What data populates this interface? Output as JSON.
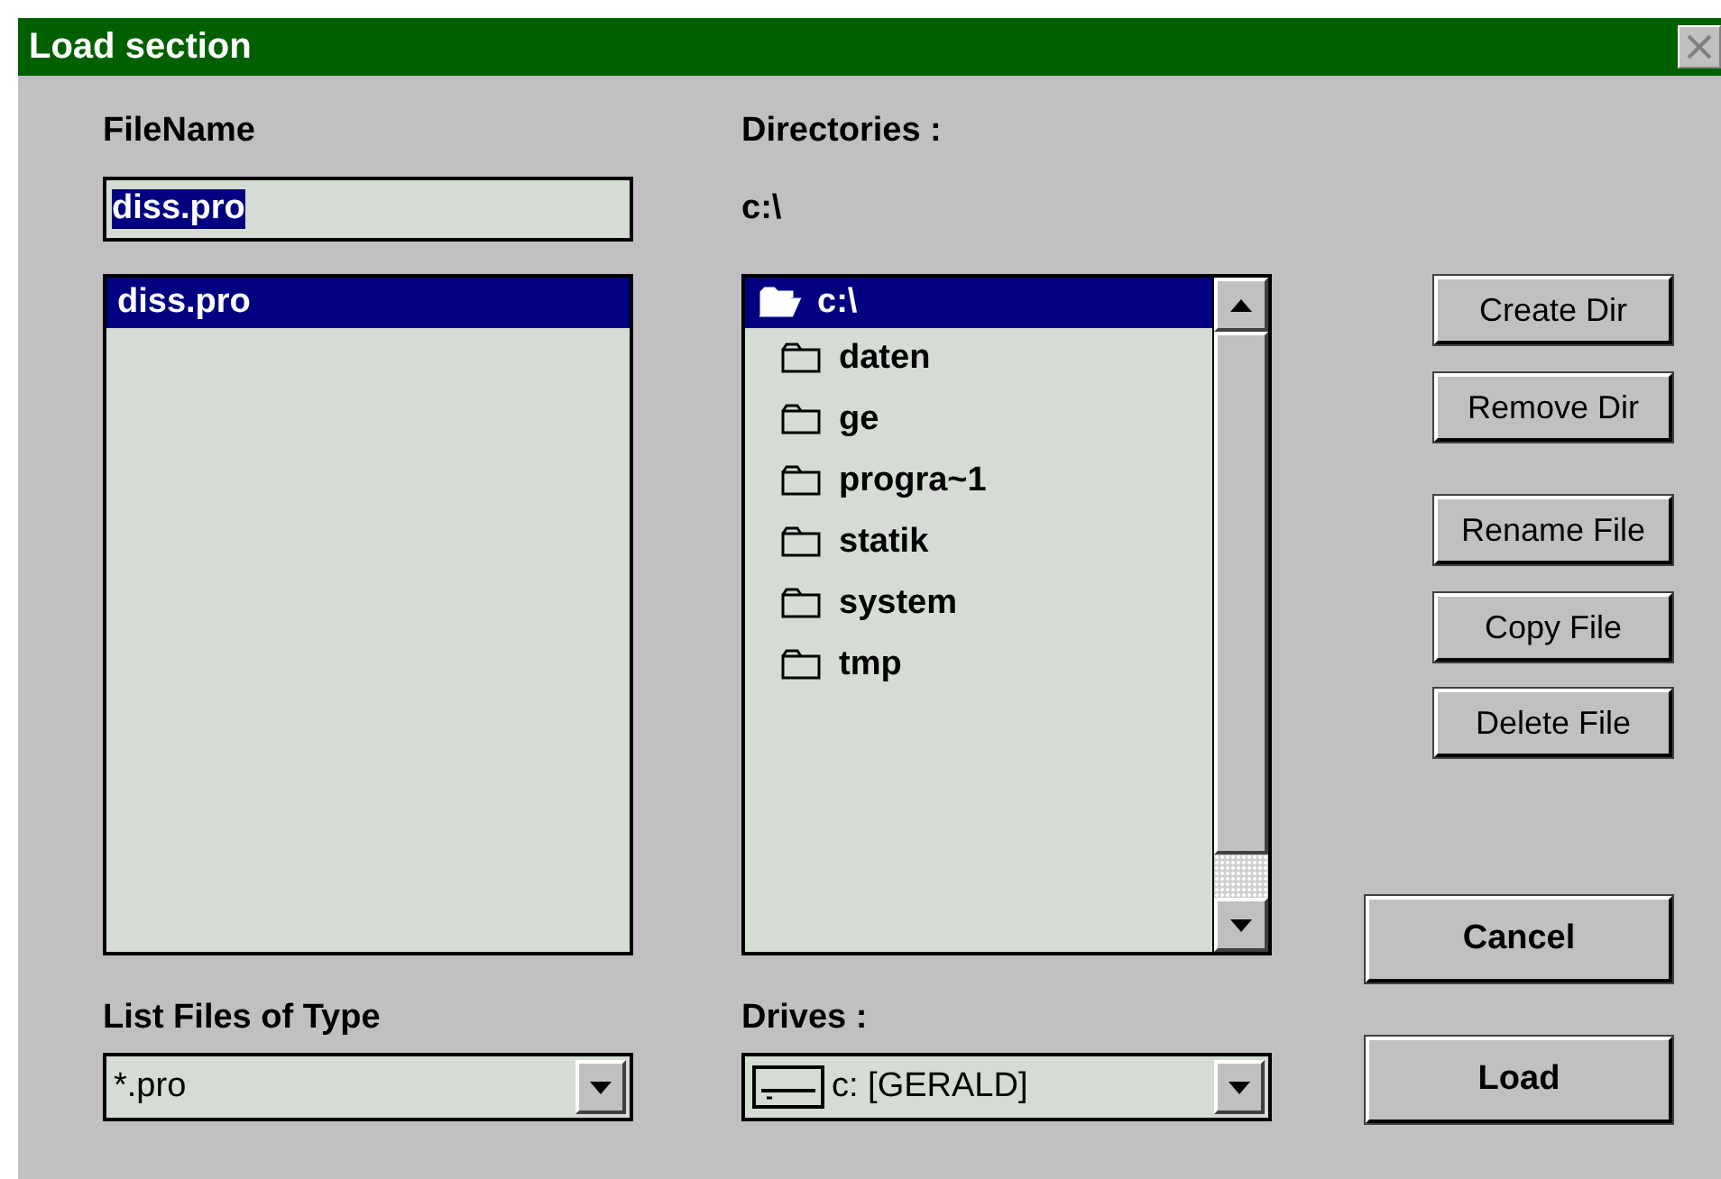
{
  "window": {
    "title": "Load section"
  },
  "file_name": {
    "label": "FileName",
    "value": "diss.pro",
    "text_selected": true
  },
  "files": [
    {
      "name": "diss.pro",
      "selected": true
    }
  ],
  "directories": {
    "label": "Directories :",
    "current_path": "c:\\"
  },
  "directory_list": [
    {
      "name": "c:\\",
      "kind": "open",
      "selected": true
    },
    {
      "name": "daten",
      "kind": "closed",
      "selected": false
    },
    {
      "name": "ge",
      "kind": "closed",
      "selected": false
    },
    {
      "name": "progra~1",
      "kind": "closed",
      "selected": false
    },
    {
      "name": "statik",
      "kind": "closed",
      "selected": false
    },
    {
      "name": "system",
      "kind": "closed",
      "selected": false
    },
    {
      "name": "tmp",
      "kind": "closed",
      "selected": false
    }
  ],
  "file_type": {
    "label": "List Files of Type",
    "value": "*.pro"
  },
  "drives": {
    "label": "Drives :",
    "value": "c: [GERALD]"
  },
  "buttons": [
    {
      "label": "Create Dir",
      "kind": "small"
    },
    {
      "label": "Remove Dir",
      "kind": "small"
    },
    {
      "label": "Rename File",
      "kind": "small"
    },
    {
      "label": "Copy File",
      "kind": "small"
    },
    {
      "label": "Delete File",
      "kind": "small"
    },
    {
      "label": "Cancel",
      "kind": "large"
    },
    {
      "label": "Load",
      "kind": "large"
    }
  ]
}
